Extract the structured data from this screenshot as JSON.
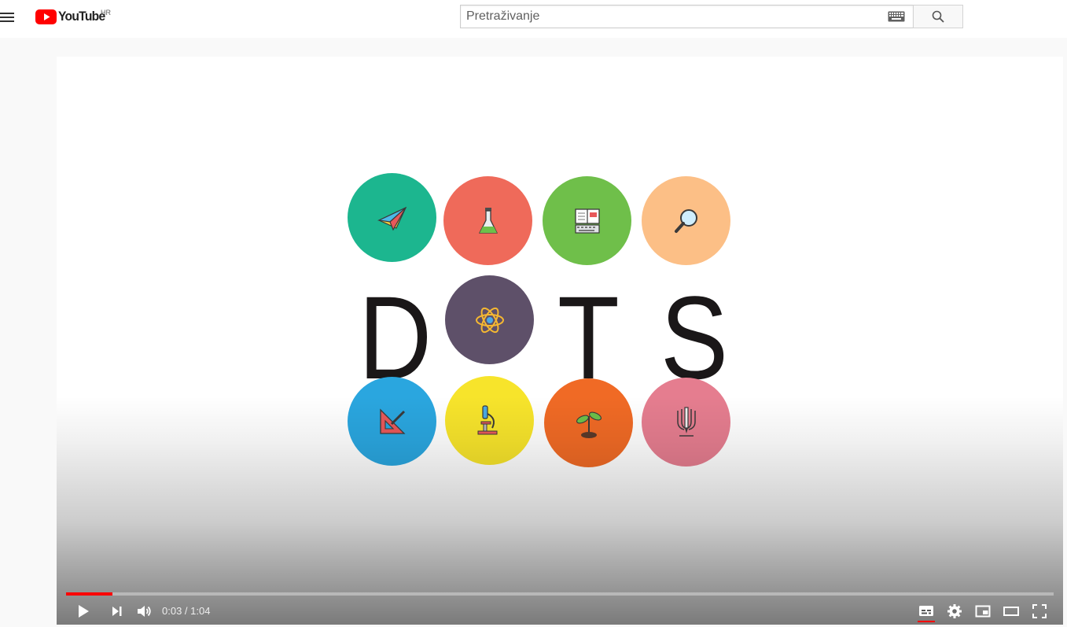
{
  "masthead": {
    "logo_text": "YouTube",
    "country_code": "HR",
    "search_placeholder": "Pretraživanje",
    "logo_color": "#ff0000"
  },
  "player": {
    "time_current": "0:03",
    "time_separator": " / ",
    "time_duration": "1:04",
    "progress_played_fraction": 0.047,
    "progress_loaded_fraction": 0.047,
    "controls": [
      "play-icon",
      "next-icon",
      "volume-icon",
      "subtitles-icon",
      "settings-icon",
      "miniplayer-icon",
      "theater-mode-icon",
      "fullscreen-icon"
    ]
  },
  "video": {
    "letters": [
      "D",
      "T",
      "S"
    ],
    "dots": [
      {
        "name": "paper-plane",
        "color": "#1cb68f"
      },
      {
        "name": "flask",
        "color": "#ef6a5a"
      },
      {
        "name": "book-keyboard",
        "color": "#6fbf4a"
      },
      {
        "name": "magnifier",
        "color": "#fcbf86"
      },
      {
        "name": "atom",
        "color": "#5e5069"
      },
      {
        "name": "set-square",
        "color": "#2aa6df"
      },
      {
        "name": "microscope",
        "color": "#f7e42b"
      },
      {
        "name": "seedling",
        "color": "#f06a25"
      },
      {
        "name": "pencil-roots",
        "color": "#e57d8f"
      }
    ]
  }
}
